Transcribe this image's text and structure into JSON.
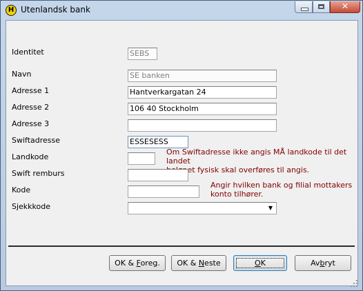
{
  "window": {
    "title": "Utenlandsk bank",
    "icon_letter": "H",
    "icon": "app-logo-icon"
  },
  "title_buttons": {
    "minimize": "minimize-icon",
    "maximize": "maximize-icon",
    "close": "close-icon",
    "close_glyph": "✕"
  },
  "form": {
    "identitet": {
      "label": "Identitet",
      "value": "SEBS"
    },
    "navn": {
      "label": "Navn",
      "value": "SE banken"
    },
    "adresse1": {
      "label": "Adresse 1",
      "value": "Hantverkargatan 24"
    },
    "adresse2": {
      "label": "Adresse 2",
      "value": "106 40 Stockholm"
    },
    "adresse3": {
      "label": "Adresse 3",
      "value": ""
    },
    "swiftadresse": {
      "label": "Swiftadresse",
      "value": "ESSESESS"
    },
    "landkode": {
      "label": "Landkode",
      "value": ""
    },
    "swift_remburs": {
      "label": "Swift remburs",
      "value": ""
    },
    "kode": {
      "label": "Kode",
      "value": ""
    },
    "sjekkkode": {
      "label": "Sjekkkode",
      "value": "",
      "arrow": "▼"
    }
  },
  "notes": {
    "swift_note_line1": "Om Swiftadresse ikke angis MÅ landkode til det landet",
    "swift_note_line2": "beløpet fysisk skal overføres til angis.",
    "kode_note_line1": "Angir hvilken bank og filial mottakers",
    "kode_note_line2": "konto tilhører."
  },
  "buttons": {
    "ok_foreg": {
      "pre": "OK & ",
      "key": "F",
      "post": "oreg."
    },
    "ok_neste": {
      "pre": "OK & ",
      "key": "N",
      "post": "este"
    },
    "ok": {
      "pre": "",
      "key": "O",
      "post": "K"
    },
    "avbryt": {
      "pre": "Av",
      "key": "b",
      "post": "ryt"
    }
  },
  "colors": {
    "note_text": "#800000",
    "readonly_text": "#808080",
    "default_button_border": "#3c7fb1"
  }
}
